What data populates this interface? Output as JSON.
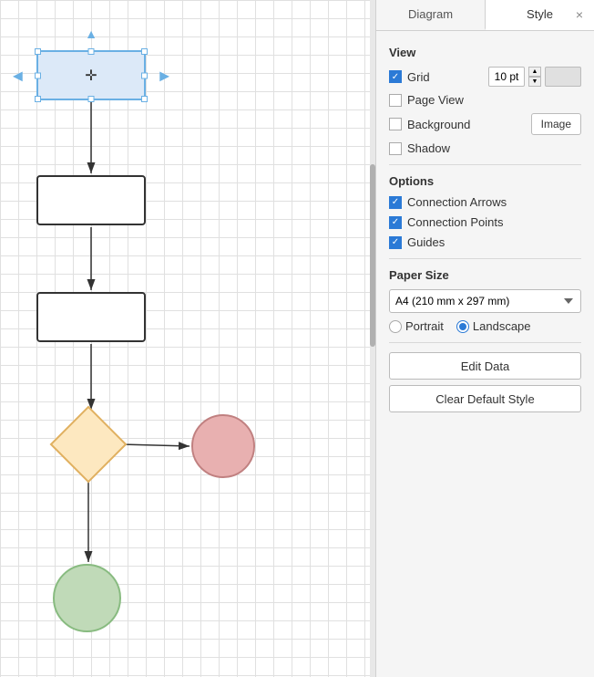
{
  "tabs": {
    "diagram_label": "Diagram",
    "style_label": "Style",
    "close_label": "×"
  },
  "view": {
    "section_title": "View",
    "grid_label": "Grid",
    "grid_value": "10 pt",
    "page_view_label": "Page View",
    "background_label": "Background",
    "background_btn": "Image",
    "shadow_label": "Shadow"
  },
  "options": {
    "section_title": "Options",
    "connection_arrows_label": "Connection Arrows",
    "connection_points_label": "Connection Points",
    "guides_label": "Guides"
  },
  "paper_size": {
    "section_title": "Paper Size",
    "value": "A4 (210 mm x 297 mm)",
    "portrait_label": "Portrait",
    "landscape_label": "Landscape"
  },
  "actions": {
    "edit_data_label": "Edit Data",
    "clear_default_style_label": "Clear Default Style"
  },
  "diagram": {
    "selected_shape_label": "selected-rect",
    "shapes": [
      {
        "id": "rect-selected",
        "type": "rect",
        "label": ""
      },
      {
        "id": "rect1",
        "type": "rect",
        "label": ""
      },
      {
        "id": "rect2",
        "type": "rect",
        "label": ""
      },
      {
        "id": "diamond",
        "type": "diamond",
        "label": ""
      },
      {
        "id": "circle-pink",
        "type": "circle",
        "label": ""
      },
      {
        "id": "circle-green",
        "type": "circle",
        "label": ""
      }
    ]
  }
}
